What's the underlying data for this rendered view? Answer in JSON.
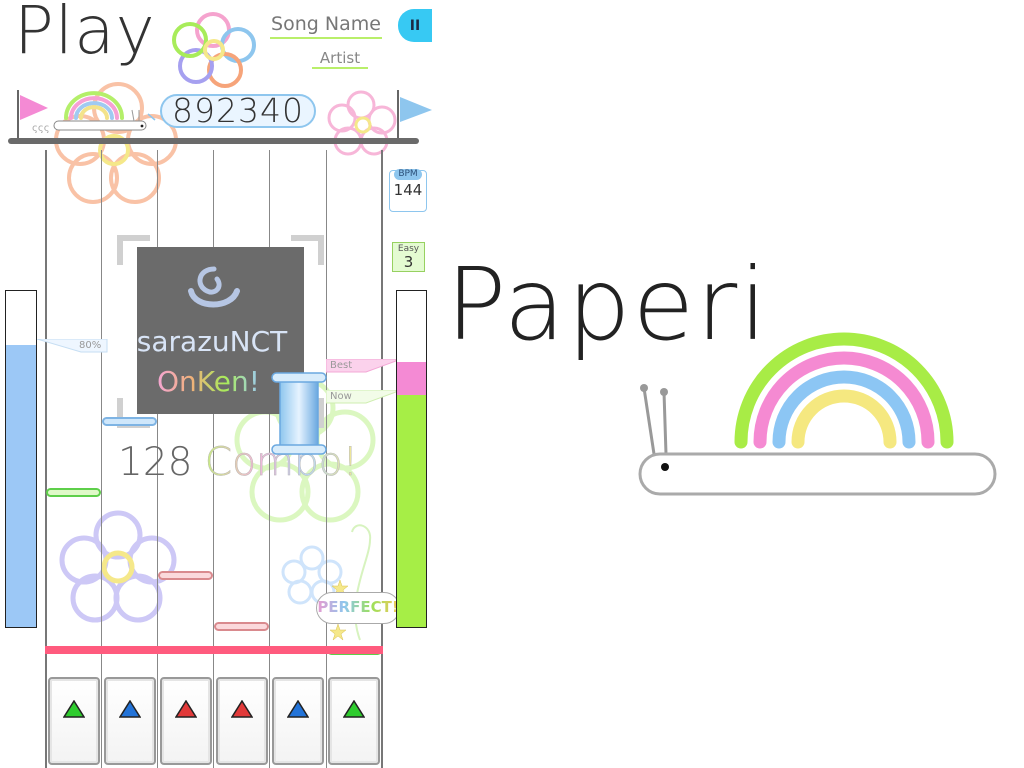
{
  "header": {
    "title": "Play",
    "song_name": "Song Name",
    "artist": "Artist",
    "pause_icon": "II"
  },
  "score": {
    "value": "892340"
  },
  "gauges": {
    "life_fraction": 0.84,
    "life_label": "80%",
    "score_fraction": 0.69,
    "best_fraction": 0.79,
    "best_label": "Best",
    "now_label": "Now"
  },
  "bpm": {
    "label": "BPM",
    "value": "144"
  },
  "difficulty": {
    "label": "Easy",
    "value": "3"
  },
  "jacket": {
    "line1": "isarazuNCT",
    "line2": "OnKen!"
  },
  "combo": {
    "count": "128",
    "word": "Combo!"
  },
  "judgement": {
    "text": "PERFECT!"
  },
  "keys": [
    {
      "icon": "up-arrow-icon",
      "color": "#2ecc2e"
    },
    {
      "icon": "up-arrow-icon",
      "color": "#2273d8"
    },
    {
      "icon": "up-arrow-icon",
      "color": "#e23a3a"
    },
    {
      "icon": "up-arrow-icon",
      "color": "#e23a3a"
    },
    {
      "icon": "up-arrow-icon",
      "color": "#2273d8"
    },
    {
      "icon": "up-arrow-icon",
      "color": "#2ecc2e"
    }
  ],
  "colors": {
    "accent_blue": "#37c9f3",
    "judge_line": "#ff5b7e",
    "life_gauge": "#9cc8f6",
    "score_gauge": "#a6ee46",
    "best_marker": "#f48ad4"
  },
  "brand": {
    "name": "Paperi"
  }
}
